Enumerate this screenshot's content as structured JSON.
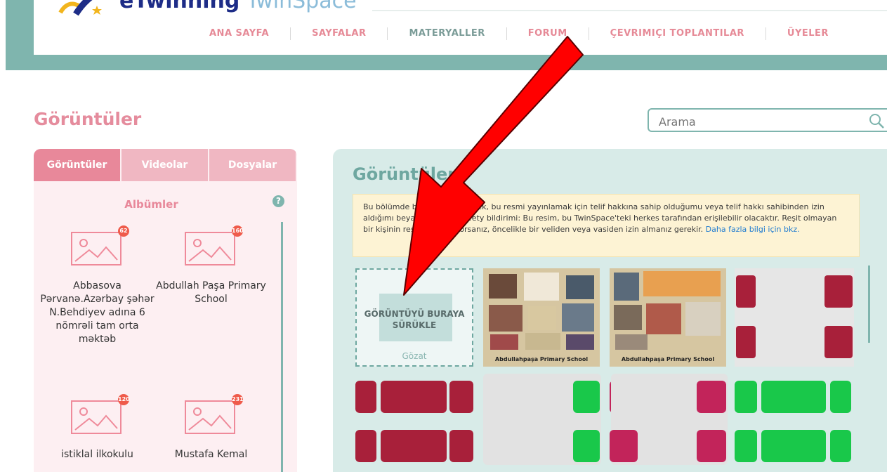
{
  "header": {
    "logo_prefix": "eTwinning",
    "logo_suffix": " TwinSpace",
    "nav": [
      {
        "label": "ANA SAYFA"
      },
      {
        "label": "SAYFALAR"
      },
      {
        "label": "MATERYALLER"
      },
      {
        "label": "FORUM"
      },
      {
        "label": "ÇEVRIMIÇI TOPLANTILAR"
      },
      {
        "label": "ÜYELER"
      }
    ]
  },
  "page_title": "Görüntüler",
  "search": {
    "placeholder": "Arama",
    "icon": "search-icon"
  },
  "left_panel": {
    "tabs": [
      {
        "label": "Görüntüler",
        "active": true
      },
      {
        "label": "Videolar",
        "active": false
      },
      {
        "label": "Dosyalar",
        "active": false
      }
    ],
    "albums_title": "Albümler",
    "help": "?",
    "albums": [
      {
        "name": "Abbasova Pərvanə.Azərbay şəhər N.Behdiyev adına 6 nömrəli tam orta məktəb",
        "count": "62"
      },
      {
        "name": "Abdullah Paşa Primary School",
        "count": "160"
      },
      {
        "name": "istiklal ilkokulu",
        "count": "120"
      },
      {
        "name": "Mustafa Kemal",
        "count": "231"
      }
    ]
  },
  "right_panel": {
    "title": "Görüntüler",
    "notice_text": "Bu bölümde bir resim ekleyerek, bu resmi yayınlamak için telif hakkına sahip olduğumu veya telif hakkı sahibinden izin aldığımı beyan ederim. eSafety bildirimi: Bu resim, bu TwinSpace'teki herkes tarafından erişilebilir olacaktır. Reşit olmayan bir kişinin resmini yüklüyorsanız, öncelikle bir veliden veya vasiden izin almanız gerekir.",
    "notice_link": "Daha fazla bilgi için bkz.",
    "drop_text": "GÖRÜNTÜYÜ BURAYA SÜRÜKLE",
    "browse": "Gözat",
    "thumbnails": [
      {
        "caption": "Abdullahpaşa Primary School"
      },
      {
        "caption": "Abdullahpaşa Primary School"
      }
    ]
  },
  "colors": {
    "accent_pink": "#e8889a",
    "accent_teal": "#7fb5ae",
    "arrow_red": "#ff0000"
  }
}
